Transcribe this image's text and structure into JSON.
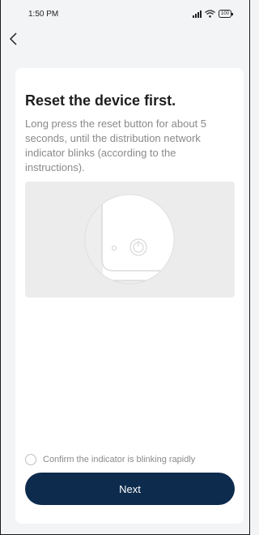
{
  "status_bar": {
    "time": "1:50 PM",
    "battery": "100",
    "icons": [
      "signal-icon",
      "wifi-icon",
      "battery-icon"
    ]
  },
  "nav": {
    "back_icon": "chevron-left-icon"
  },
  "content": {
    "title": "Reset the device first.",
    "description": "Long press the reset button for about 5 seconds, until the distribution network indicator blinks (according to the instructions).",
    "illustration_icon": "device-power-button-illustration"
  },
  "confirm": {
    "label": "Confirm the indicator is blinking rapidly",
    "checked": false
  },
  "actions": {
    "next_label": "Next"
  },
  "colors": {
    "primary_button": "#0d2b4d",
    "background": "#f3f4f6",
    "card": "#ffffff",
    "muted_text": "#8a8a8a"
  }
}
